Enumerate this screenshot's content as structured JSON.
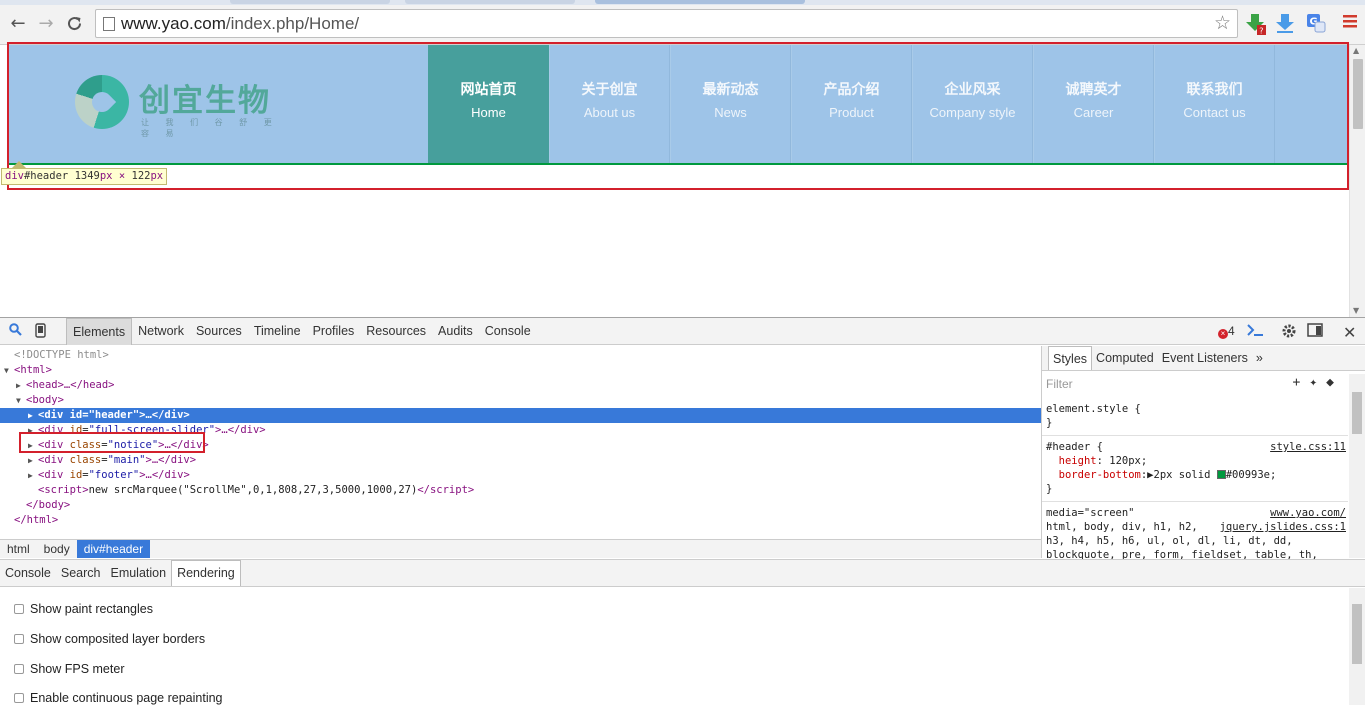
{
  "browser": {
    "url_host": "www.yao.com",
    "url_path": "/index.php/Home/"
  },
  "site": {
    "logo_text": "创宜生物",
    "logo_tagline": "让 我 们 谷 舒 更 容 易",
    "nav": [
      {
        "cn": "网站首页",
        "en": "Home",
        "active": true
      },
      {
        "cn": "关于创宜",
        "en": "About us"
      },
      {
        "cn": "最新动态",
        "en": "News"
      },
      {
        "cn": "产品介绍",
        "en": "Product"
      },
      {
        "cn": "企业风采",
        "en": "Company style"
      },
      {
        "cn": "诚聘英才",
        "en": "Career"
      },
      {
        "cn": "联系我们",
        "en": "Contact us"
      }
    ],
    "colors": {
      "header_bg": "#9ec4e8",
      "active_nav": "#479f9c",
      "border": "#00993e",
      "highlight": "#d3202c"
    }
  },
  "inspect_tooltip": {
    "tag": "div",
    "selector": "#header",
    "width": "1349",
    "height": "122",
    "unit": "px",
    "times": "×"
  },
  "devtools": {
    "tabs": [
      "Elements",
      "Network",
      "Sources",
      "Timeline",
      "Profiles",
      "Resources",
      "Audits",
      "Console"
    ],
    "error_count": "4",
    "dom": {
      "doctype": "<!DOCTYPE html>",
      "html_open": "<html>",
      "head": "<head>…</head>",
      "body_open": "<body>",
      "header_div": {
        "open": "<div id=\"header\">",
        "tail": "…</div>"
      },
      "slider_div": {
        "tag": "div",
        "attr": "id",
        "value": "\"full-screen-slider\""
      },
      "notice_div": {
        "tag": "div",
        "attr": "class",
        "value": "\"notice\""
      },
      "main_div": {
        "tag": "div",
        "attr": "class",
        "value": "\"main\""
      },
      "footer_div": {
        "tag": "div",
        "attr": "id",
        "value": "\"footer\""
      },
      "script_code": "new srcMarquee(\"ScrollMe\",0,1,808,27,3,5000,1000,27)",
      "body_close": "</body>",
      "html_close": "</html>",
      "ellipsis_close": ">…</div>"
    },
    "breadcrumbs": [
      "html",
      "body",
      "div#header"
    ],
    "styles_tabs": [
      "Styles",
      "Computed",
      "Event Listeners",
      "»"
    ],
    "filter_placeholder": "Filter",
    "styles": {
      "element_style": "element.style {",
      "close": "}",
      "header_selector": "#header {",
      "header_source": "style.css:11",
      "height_prop": "height",
      "height_val": "120px;",
      "border_prop": "border-bottom",
      "border_val": "2px solid",
      "border_color": "#00993e;",
      "media": "media=\"screen\"",
      "media_source": "www.yao.com/",
      "rule_line1": "html, body, div, h1, h2,",
      "rule_source": "jquery.jslides.css:1",
      "rule_line2": "h3, h4, h5, h6, ul, ol, dl, li, dt, dd,",
      "rule_line3": "blockquote, pre, form, fieldset, table, th,"
    },
    "drawer_tabs": [
      "Console",
      "Search",
      "Emulation",
      "Rendering"
    ],
    "rendering_options": [
      "Show paint rectangles",
      "Show composited layer borders",
      "Show FPS meter",
      "Enable continuous page repainting"
    ]
  }
}
